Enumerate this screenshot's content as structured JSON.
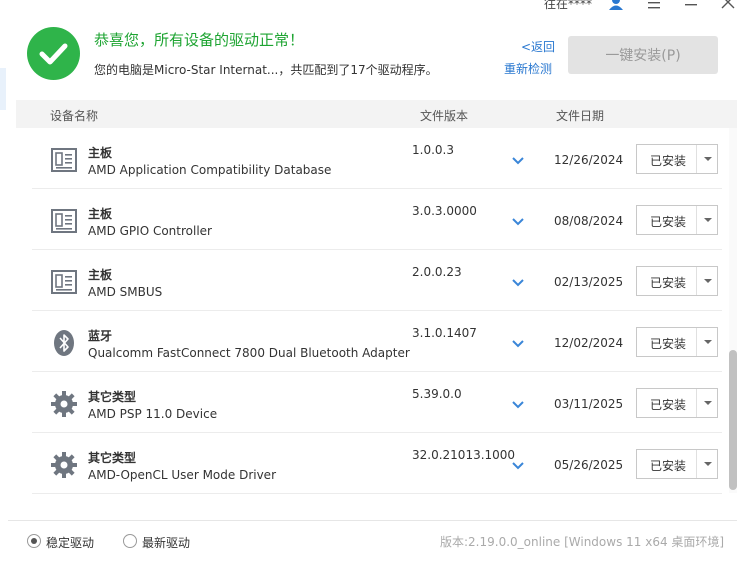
{
  "titlebar": {
    "user_name": "往在****",
    "icons": [
      "user-icon",
      "menu-icon",
      "minimize-icon",
      "close-icon"
    ]
  },
  "header": {
    "status_title": "恭喜您，所有设备的驱动正常！",
    "status_subtitle": "您的电脑是Micro-Star Internat...，共匹配到了17个驱动程序。",
    "back_link": "<返回",
    "rescan_link": "重新检测",
    "install_all_button": "一键安装(P)"
  },
  "columns": {
    "name": "设备名称",
    "version": "文件版本",
    "date": "文件日期"
  },
  "devices": [
    {
      "icon": "motherboard-icon",
      "category": "主板",
      "name": "AMD Application Compatibility Database",
      "version": "1.0.0.3",
      "date": "12/26/2024",
      "state": "已安装"
    },
    {
      "icon": "motherboard-icon",
      "category": "主板",
      "name": "AMD GPIO Controller",
      "version": "3.0.3.0000",
      "date": "08/08/2024",
      "state": "已安装"
    },
    {
      "icon": "motherboard-icon",
      "category": "主板",
      "name": "AMD SMBUS",
      "version": "2.0.0.23",
      "date": "02/13/2025",
      "state": "已安装"
    },
    {
      "icon": "bluetooth-icon",
      "category": "蓝牙",
      "name": "Qualcomm FastConnect 7800 Dual Bluetooth Adapter",
      "version": "3.1.0.1407",
      "date": "12/02/2024",
      "state": "已安装"
    },
    {
      "icon": "gear-icon",
      "category": "其它类型",
      "name": "AMD PSP 11.0 Device",
      "version": "5.39.0.0",
      "date": "03/11/2025",
      "state": "已安装"
    },
    {
      "icon": "gear-icon",
      "category": "其它类型",
      "name": "AMD-OpenCL User Mode Driver",
      "version": "32.0.21013.1000",
      "date": "05/26/2025",
      "state": "已安装"
    }
  ],
  "footer": {
    "stable_driver": "稳定驱动",
    "latest_driver": "最新驱动",
    "selected": "稳定驱动",
    "version_info": "版本:2.19.0.0_online [Windows 11 x64 桌面环境]"
  },
  "colors": {
    "success_green": "#2fb44a",
    "title_green": "#1ea432",
    "link_blue": "#2a78d0",
    "icon_gray": "#6f7680",
    "chevron_blue": "#3a86d8"
  }
}
